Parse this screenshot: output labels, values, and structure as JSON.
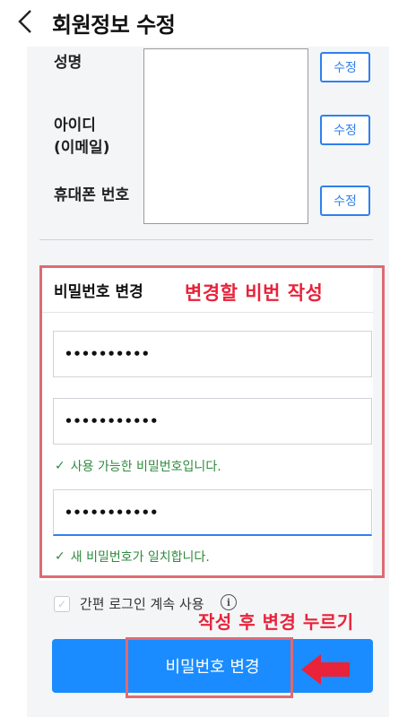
{
  "header": {
    "title": "회원정보 수정"
  },
  "profile": {
    "name_label": "성명",
    "id_label_line1": "아이디",
    "id_label_line2": "(이메일)",
    "phone_label": "휴대폰 번호",
    "edit_label": "수정"
  },
  "password": {
    "section_title": "비밀번호 변경",
    "current_value": "••••••••••",
    "new_value": "•••••••••••",
    "new_ok_message": "사용 가능한 비밀번호입니다.",
    "confirm_value": "•••••••••••",
    "confirm_ok_message": "새 비밀번호가 일치합니다."
  },
  "auto_login": {
    "label": "간편 로그인 계속 사용"
  },
  "submit": {
    "label": "비밀번호 변경"
  },
  "annotations": {
    "write_pw": "변경할 비번 작성",
    "press_change": "작성 후 변경 누르기"
  },
  "colors": {
    "accent": "#1a8cff",
    "ok": "#2e8b3e",
    "annotation": "#e8233a"
  }
}
